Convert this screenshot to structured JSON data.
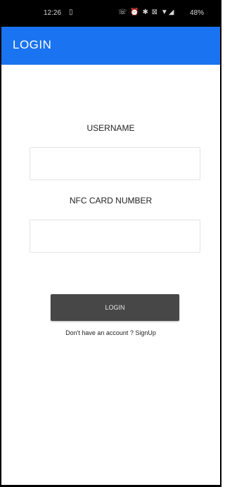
{
  "status_bar": {
    "time": "12:26",
    "sim_icon": "sim-card-icon",
    "icons": "☏ ⏰ ✱ ⊠ ▼◢",
    "battery": "48%"
  },
  "app_bar": {
    "title": "LOGIN"
  },
  "form": {
    "username_label": "USERNAME",
    "username_value": "",
    "nfc_label": "NFC CARD NUMBER",
    "nfc_value": "",
    "login_button": "LOGIN",
    "signup_text": "Don't have an account ? SignUp"
  },
  "colors": {
    "app_bar": "#1a73f0",
    "button": "#474747",
    "status_bar": "#000000"
  }
}
